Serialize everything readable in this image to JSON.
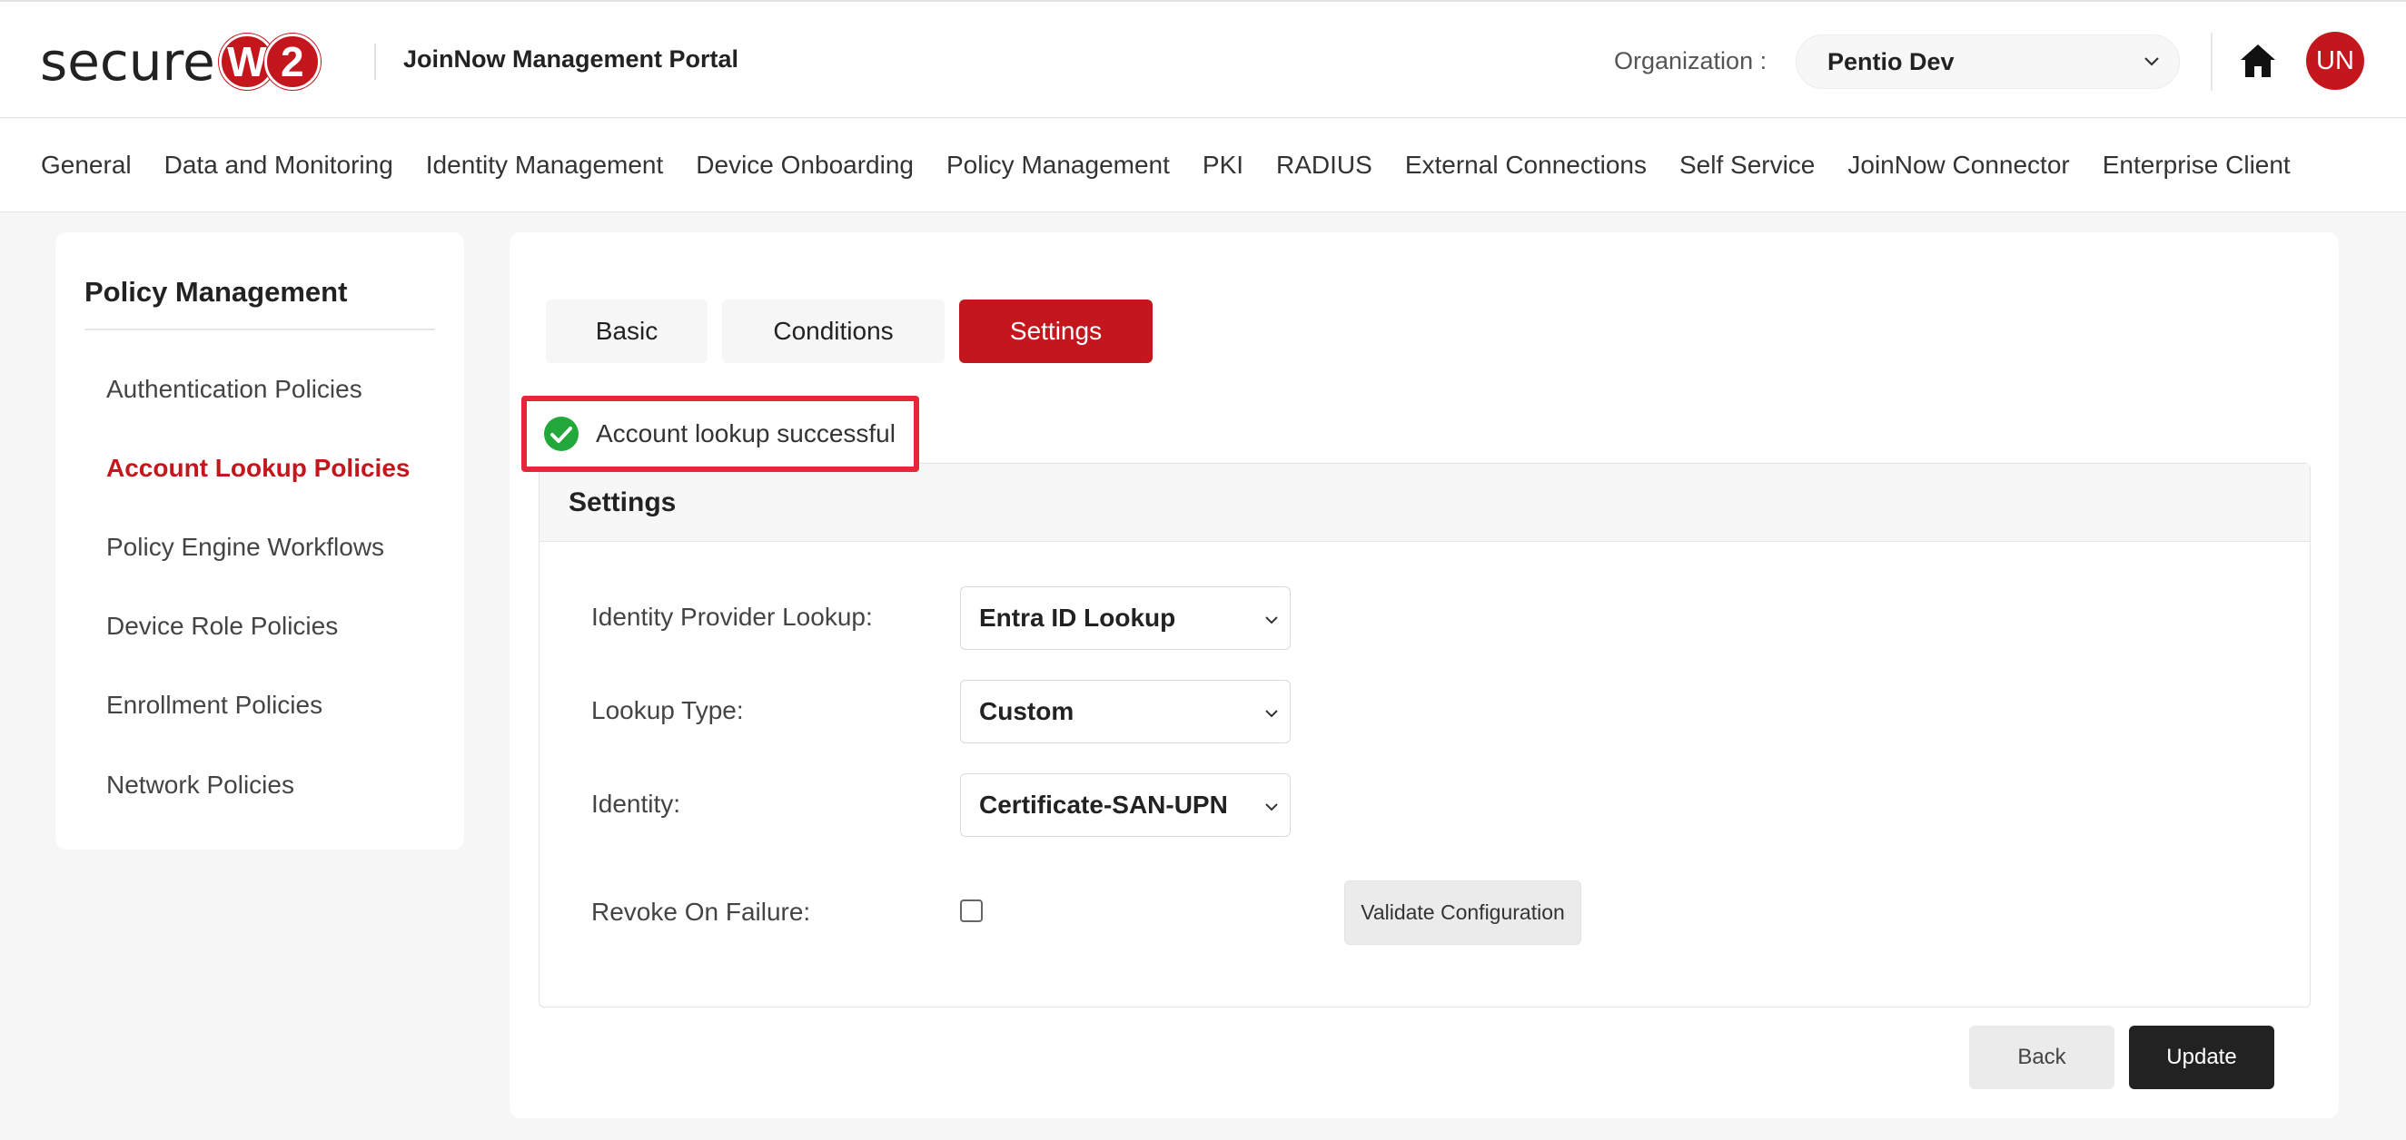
{
  "brand": {
    "logo_text": "secure",
    "logo_w": "W",
    "logo_2": "2",
    "portal_title": "JoinNow Management Portal",
    "accent_color": "#c4171d"
  },
  "header": {
    "org_label": "Organization :",
    "org_value": "Pentio Dev",
    "avatar_initials": "UN",
    "home_icon": "home-icon"
  },
  "nav": {
    "items": [
      "General",
      "Data and Monitoring",
      "Identity Management",
      "Device Onboarding",
      "Policy Management",
      "PKI",
      "RADIUS",
      "External Connections",
      "Self Service",
      "JoinNow Connector",
      "Enterprise Client"
    ]
  },
  "sidebar": {
    "title": "Policy Management",
    "items": [
      {
        "label": "Authentication Policies",
        "active": false
      },
      {
        "label": "Account Lookup Policies",
        "active": true
      },
      {
        "label": "Policy Engine Workflows",
        "active": false
      },
      {
        "label": "Device Role Policies",
        "active": false
      },
      {
        "label": "Enrollment Policies",
        "active": false
      },
      {
        "label": "Network Policies",
        "active": false
      }
    ]
  },
  "tabs": [
    {
      "label": "Basic",
      "active": false
    },
    {
      "label": "Conditions",
      "active": false
    },
    {
      "label": "Settings",
      "active": true
    }
  ],
  "alert": {
    "text": "Account lookup successful",
    "icon": "check-circle-icon",
    "color": "#22a83a"
  },
  "settings": {
    "title": "Settings",
    "identity_provider_lookup": {
      "label": "Identity Provider Lookup:",
      "value": "Entra ID Lookup"
    },
    "lookup_type": {
      "label": "Lookup Type:",
      "value": "Custom"
    },
    "identity": {
      "label": "Identity:",
      "value": "Certificate-SAN-UPN"
    },
    "revoke_on_failure": {
      "label": "Revoke On Failure:",
      "checked": false
    },
    "validate_label": "Validate Configuration"
  },
  "actions": {
    "back_label": "Back",
    "update_label": "Update"
  }
}
